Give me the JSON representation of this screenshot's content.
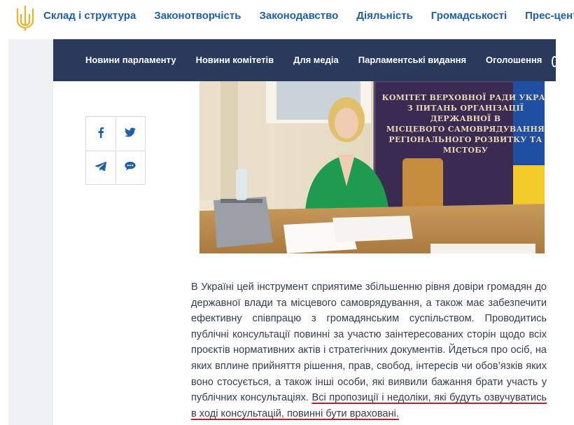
{
  "header": {
    "nav": [
      {
        "label": "Склад і структура"
      },
      {
        "label": "Законотворчість"
      },
      {
        "label": "Законодавство"
      },
      {
        "label": "Діяльність"
      },
      {
        "label": "Громадськості"
      },
      {
        "label": "Прес-центр"
      }
    ]
  },
  "subnav": {
    "items": [
      {
        "label": "Новини парламенту"
      },
      {
        "label": "Новини комітетів"
      },
      {
        "label": "Для медіа"
      },
      {
        "label": "Парламентські видання"
      },
      {
        "label": "Оголошення"
      }
    ]
  },
  "share": {
    "icons": [
      "facebook-icon",
      "twitter-icon",
      "telegram-icon",
      "chat-icon"
    ]
  },
  "photo": {
    "banner_lines": [
      "КОМІТЕТ ВЕРХОВНОЇ РАДИ УКРАЇ",
      "З ПИТАНЬ ОРГАНІЗАЦІЇ ДЕРЖАВНОЇ В",
      "МІСЦЕВОГО САМОВРЯДУВАННЯ",
      "РЕГІОНАЛЬНОГО РОЗВИТКУ ТА МІСТОБУ"
    ]
  },
  "article": {
    "text": "В Україні цей інструмент сприятиме збільшенню рівня довіри громадян до державної влади та місцевого самоврядування, а також має забезпечити ефективну співпрацю з громадянським суспільством. Проводитись публічні консультації повинні за участю заінтересованих сторін щодо всіх проєктів нормативних актів і стратегічних документів. Йдеться про осіб, на яких вплине прийняття рішення, прав, свобод, інтересів чи обов’язків яких воно стосується, а також інші особи, які виявили бажання брати участь у публічних консультаціях.",
    "highlight": "Всі пропозиції і недоліки, які будуть озвучуватись в ході консультацій, повинні бути враховані."
  },
  "colors": {
    "nav_blue": "#1d5fa8",
    "subnav_bg": "#2a3a5c",
    "underline_red": "#d1192b",
    "body_text": "#333d4d"
  }
}
